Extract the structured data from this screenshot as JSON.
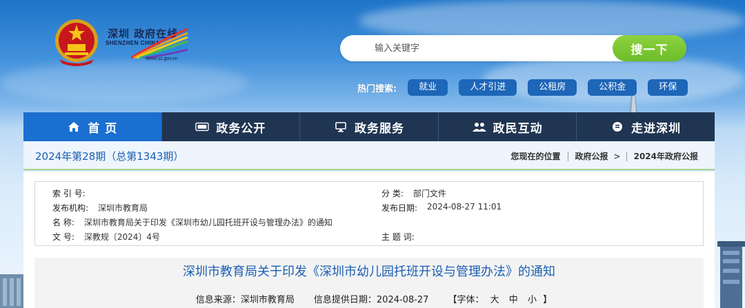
{
  "header": {
    "logo": {
      "cn": "深圳 政府在线",
      "en": "SHENZHEN CHINA",
      "url": "www.sz.gov.cn"
    },
    "search": {
      "placeholder": "输入关键字",
      "button_label": "搜一下"
    },
    "hot_search": {
      "label": "热门搜索:",
      "tags": [
        "就业",
        "人才引进",
        "公租房",
        "公积金",
        "环保"
      ]
    }
  },
  "nav": {
    "items": [
      {
        "label": "首 页",
        "icon": "home-icon"
      },
      {
        "label": "政务公开",
        "icon": "news-icon"
      },
      {
        "label": "政务服务",
        "icon": "monitor-icon"
      },
      {
        "label": "政民互动",
        "icon": "people-icon"
      },
      {
        "label": "走进深圳",
        "icon": "speech-icon"
      }
    ]
  },
  "breadcrumb_bar": {
    "issue_title": "2024年第28期（总第1343期）",
    "location_label": "您现在的位置",
    "crumbs": [
      "政府公报",
      "2024年政府公报"
    ]
  },
  "meta": {
    "index_no": {
      "key": "索 引 号:",
      "value": ""
    },
    "category": {
      "key": "分    类:",
      "value": "部门文件"
    },
    "publisher": {
      "key": "发布机构:",
      "value": "深圳市教育局"
    },
    "publish_date": {
      "key": "发布日期:",
      "value": "2024-08-27 11:01"
    },
    "name": {
      "key": "名    称:",
      "value": "深圳市教育局关于印发《深圳市幼儿园托班开设与管理办法》的通知"
    },
    "doc_no": {
      "key": "文    号:",
      "value": "深教规〔2024〕4号"
    },
    "subject": {
      "key": "主 题 词:",
      "value": ""
    }
  },
  "article": {
    "title": "深圳市教育局关于印发《深圳市幼儿园托班开设与管理办法》的通知",
    "source": "信息来源：深圳市教育局",
    "date": "信息提供日期：2024-08-27",
    "font_label": "【字体：",
    "font_sizes": [
      "大",
      "中",
      "小"
    ],
    "font_close": "】"
  },
  "colors": {
    "nav_active": "#1b6fd0",
    "nav_bg": "#1f3552",
    "search_button": "#6cbd2a",
    "hot_tag": "#1d66b8",
    "link_blue": "#1b5fb2"
  }
}
